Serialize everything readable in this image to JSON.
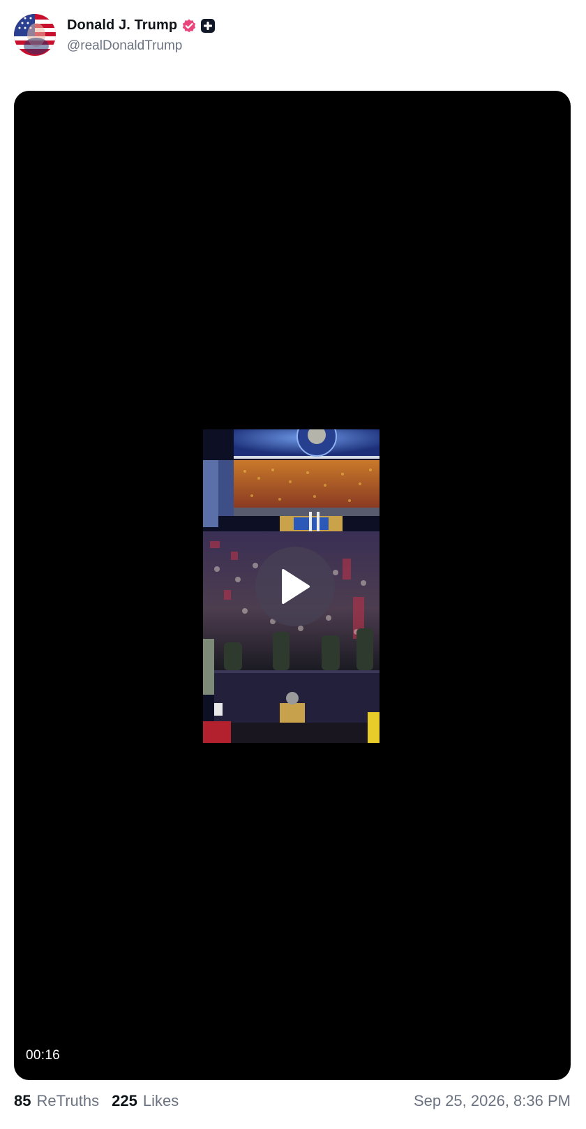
{
  "post": {
    "author": {
      "display_name": "Donald J. Trump",
      "handle": "@realDonaldTrump",
      "avatar_icon": "flag-portrait-avatar",
      "verified_icon": "verified-badge-icon",
      "verified_color": "#e8467c",
      "plus_icon": "plus-badge-icon"
    },
    "video": {
      "duration": "00:16",
      "play_icon": "play-icon"
    },
    "stats": {
      "retruths_count": "85",
      "retruths_label": "ReTruths",
      "likes_count": "225",
      "likes_label": "Likes"
    },
    "timestamp": "Sep 25, 2026, 8:36 PM"
  }
}
